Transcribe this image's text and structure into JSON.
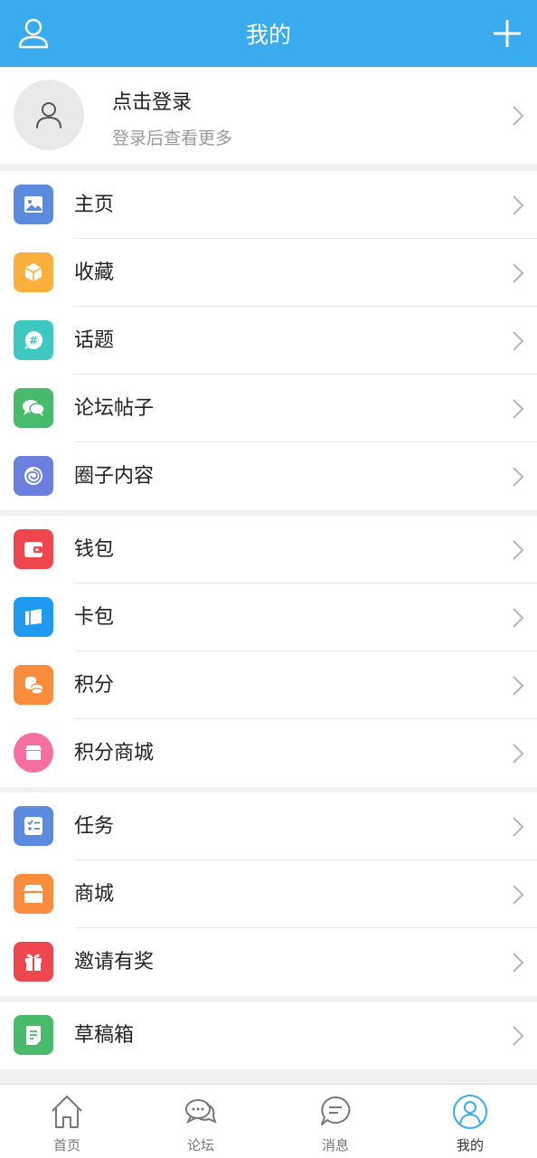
{
  "header": {
    "title": "我的",
    "left_icon": "user-icon",
    "right_icon": "plus-icon",
    "color": "#3aabef"
  },
  "profile": {
    "login_label": "点击登录",
    "hint": "登录后查看更多"
  },
  "menu": {
    "group1": [
      {
        "label": "主页",
        "icon": "image-icon",
        "color": "#5b8bdf"
      },
      {
        "label": "收藏",
        "icon": "box-icon",
        "color": "#fbb03b"
      },
      {
        "label": "话题",
        "icon": "hashtag-bubble-icon",
        "color": "#3ec8c1"
      },
      {
        "label": "论坛帖子",
        "icon": "chat-bubbles-icon",
        "color": "#47bb6a"
      },
      {
        "label": "圈子内容",
        "icon": "swirl-icon",
        "color": "#6a7fde"
      }
    ],
    "group2": [
      {
        "label": "钱包",
        "icon": "wallet-icon",
        "color": "#f0474e"
      },
      {
        "label": "卡包",
        "icon": "card-icon",
        "color": "#1e9bf0"
      },
      {
        "label": "积分",
        "icon": "coins-icon",
        "color": "#fb8c3b"
      },
      {
        "label": "积分商城",
        "icon": "shop-icon",
        "color": "#f56ea1"
      }
    ],
    "group3": [
      {
        "label": "任务",
        "icon": "task-list-icon",
        "color": "#5b8bdf"
      },
      {
        "label": "商城",
        "icon": "store-icon",
        "color": "#fb8c3b"
      },
      {
        "label": "邀请有奖",
        "icon": "gift-icon",
        "color": "#f0474e"
      }
    ],
    "group4": [
      {
        "label": "草稿箱",
        "icon": "draft-icon",
        "color": "#47bb6a"
      }
    ]
  },
  "tabbar": {
    "tabs": [
      {
        "label": "首页",
        "icon": "home-icon"
      },
      {
        "label": "论坛",
        "icon": "forum-icon"
      },
      {
        "label": "消息",
        "icon": "message-icon"
      },
      {
        "label": "我的",
        "icon": "profile-icon",
        "active": true
      }
    ]
  }
}
